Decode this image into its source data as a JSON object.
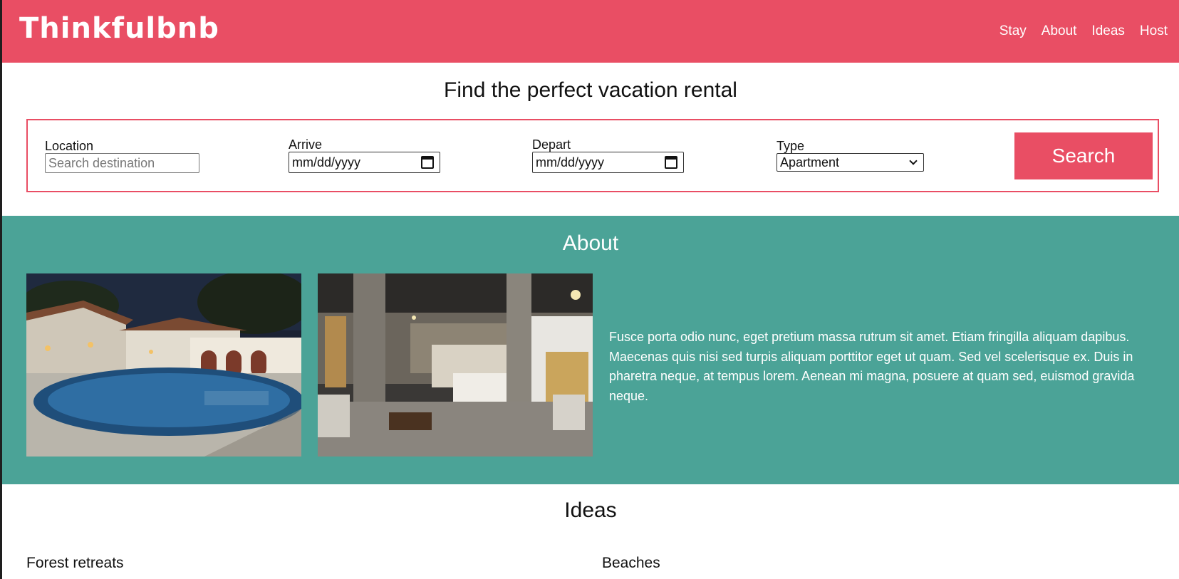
{
  "header": {
    "logo": "Thinkfulbnb",
    "nav": [
      "Stay",
      "About",
      "Ideas",
      "Host"
    ]
  },
  "search": {
    "title": "Find the perfect vacation rental",
    "location_label": "Location",
    "location_placeholder": "Search destination",
    "arrive_label": "Arrive",
    "arrive_value": "mm/dd/yyyy",
    "depart_label": "Depart",
    "depart_value": "mm/dd/yyyy",
    "type_label": "Type",
    "type_value": "Apartment",
    "button": "Search"
  },
  "about": {
    "title": "About",
    "text": "Fusce porta odio nunc, eget pretium massa rutrum sit amet. Etiam fringilla aliquam dapibus. Maecenas quis nisi sed turpis aliquam porttitor eget ut quam. Sed vel scelerisque ex. Duis in pharetra neque, at tempus lorem. Aenean mi magna, posuere at quam sed, euismod gravida neque."
  },
  "ideas": {
    "title": "Ideas",
    "items": [
      "Forest retreats",
      "Beaches"
    ]
  },
  "colors": {
    "brand": "#e94e64",
    "about_bg": "#4ba397"
  }
}
